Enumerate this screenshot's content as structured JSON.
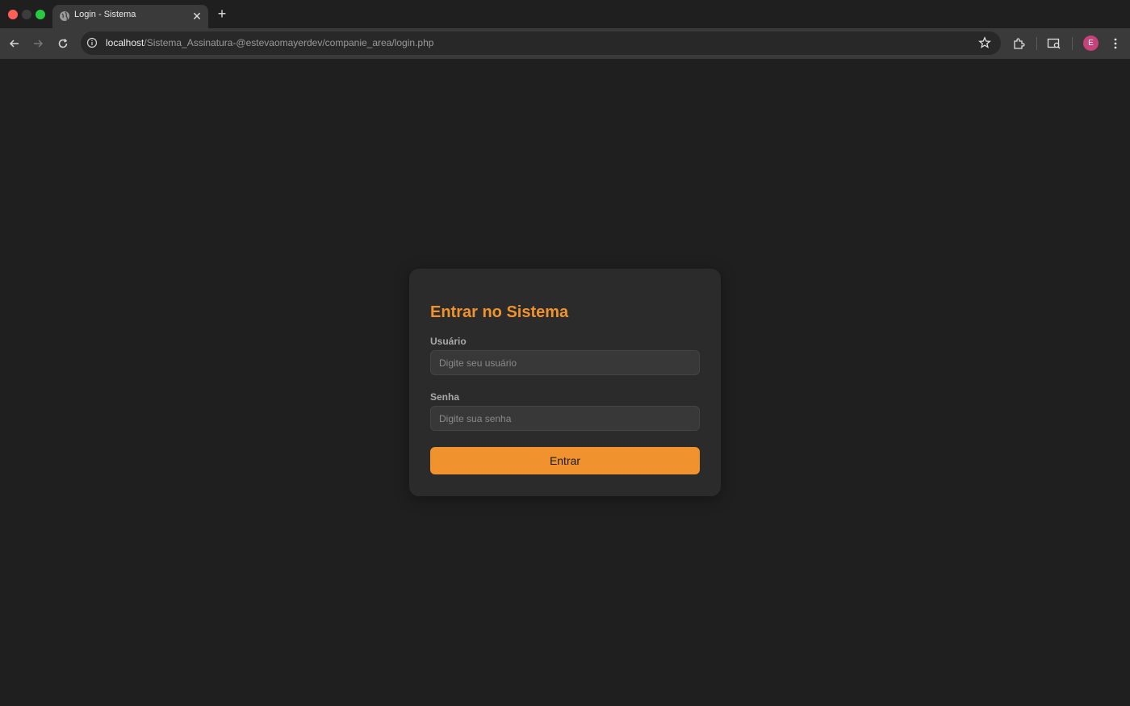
{
  "browser": {
    "tab_title": "Login - Sistema",
    "url_host": "localhost",
    "url_path": "/Sistema_Assinatura-@estevaomayerdev/companie_area/login.php",
    "profile_initial": "E",
    "icons": [
      "globe-icon",
      "close-icon",
      "plus-icon",
      "back-arrow-icon",
      "forward-arrow-icon",
      "reload-icon",
      "info-icon",
      "star-icon",
      "extensions-icon",
      "cast-icon",
      "menu-icon"
    ]
  },
  "login": {
    "title": "Entrar no Sistema",
    "user_label": "Usuário",
    "user_placeholder": "Digite seu usuário",
    "password_label": "Senha",
    "password_placeholder": "Digite sua senha",
    "submit_label": "Entrar"
  },
  "colors": {
    "accent": "#f0932f",
    "background": "#1f1f1f",
    "card": "#2b2b2b"
  }
}
